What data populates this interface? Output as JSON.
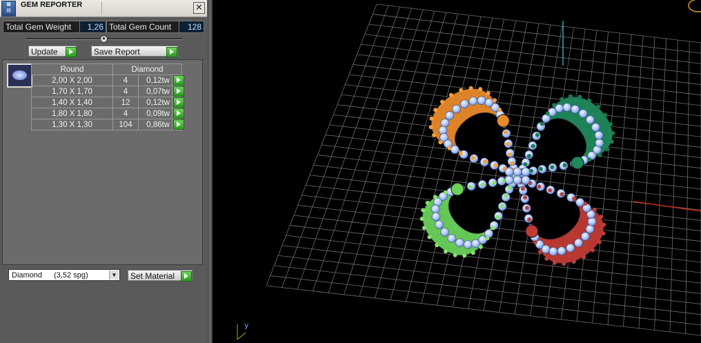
{
  "window": {
    "title": "GEM REPORTER",
    "close_label": "✕"
  },
  "stats": {
    "weight_label": "Total Gem Weight",
    "weight_value": "1,26",
    "count_label": "Total Gem Count",
    "count_value": "128"
  },
  "toolbar": {
    "update_label": "Update",
    "save_label": "Save Report"
  },
  "table": {
    "headers": [
      "Round",
      "Diamond"
    ],
    "rows": [
      {
        "size": "2,00 X 2,00",
        "count": "4",
        "weight": "0,12tw"
      },
      {
        "size": "1,70 X 1,70",
        "count": "4",
        "weight": "0,07tw"
      },
      {
        "size": "1,40 X 1,40",
        "count": "12",
        "weight": "0,12tw"
      },
      {
        "size": "1,80 X 1,80",
        "count": "4",
        "weight": "0,09tw"
      },
      {
        "size": "1,30 X 1,30",
        "count": "104",
        "weight": "0,86tw"
      }
    ]
  },
  "material": {
    "selected": "Diamond",
    "spg": "(3,52 spg)",
    "set_label": "Set Material"
  },
  "viewport": {
    "axis_label": "y",
    "colors": {
      "orange": "#e88a2a",
      "teal": "#1f8a5c",
      "green": "#6ad25a",
      "red": "#c23a34",
      "gem": "#a9c4f5",
      "grid": "#6e6e6e"
    }
  }
}
